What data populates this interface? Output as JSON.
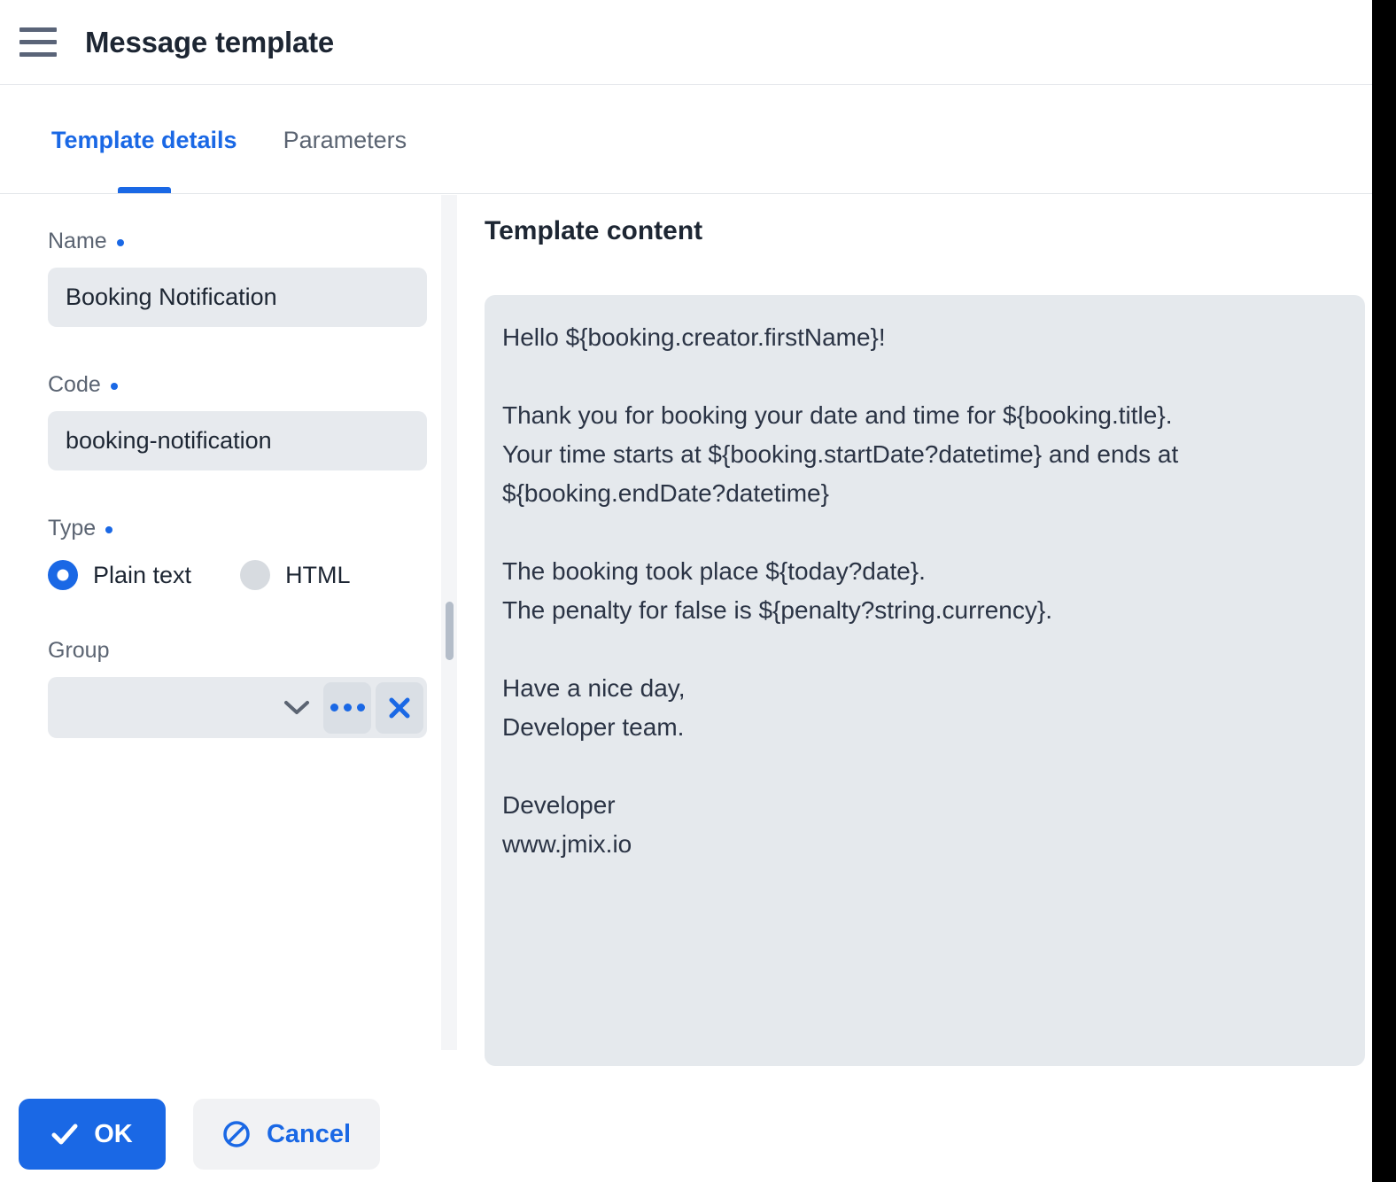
{
  "window": {
    "title": "Message template",
    "menu_icon": "hamburger-menu-icon"
  },
  "tabs": [
    {
      "label": "Template details",
      "active": true
    },
    {
      "label": "Parameters",
      "active": false
    }
  ],
  "form": {
    "name": {
      "label": "Name",
      "required_marker": "•",
      "value": "Booking Notification"
    },
    "code": {
      "label": "Code",
      "required_marker": "•",
      "value": "booking-notification"
    },
    "type": {
      "label": "Type",
      "required_marker": "•",
      "options": [
        {
          "label": "Plain text",
          "selected": true
        },
        {
          "label": "HTML",
          "selected": false
        }
      ]
    },
    "group": {
      "label": "Group",
      "value": "",
      "placeholder": "",
      "chevron_icon": "chevron-down-icon",
      "lookup_icon": "ellipsis-icon",
      "clear_icon": "close-x-icon"
    }
  },
  "content": {
    "title": "Template content",
    "text": "Hello ${booking.creator.firstName}!\n\nThank you for booking your date and time for ${booking.title}.\nYour time starts at ${booking.startDate?datetime} and ends at ${booking.endDate?datetime}\n\nThe booking took place ${today?date}.\nThe penalty for false is ${penalty?string.currency}.\n\nHave a nice day,\nDeveloper team.\n\nDeveloper\nwww.jmix.io"
  },
  "footer": {
    "ok": {
      "label": "OK",
      "icon": "check-icon"
    },
    "cancel": {
      "label": "Cancel",
      "icon": "ban-icon"
    }
  },
  "colors": {
    "accent": "#1a68e5",
    "field_bg": "#e7eaee",
    "content_bg": "#e5e9ed",
    "text": "#1d2633",
    "muted_text": "#5b6472",
    "splitter_track": "#f4f5f7",
    "splitter_handle": "#b4bdc9",
    "gutter": "#000000"
  }
}
